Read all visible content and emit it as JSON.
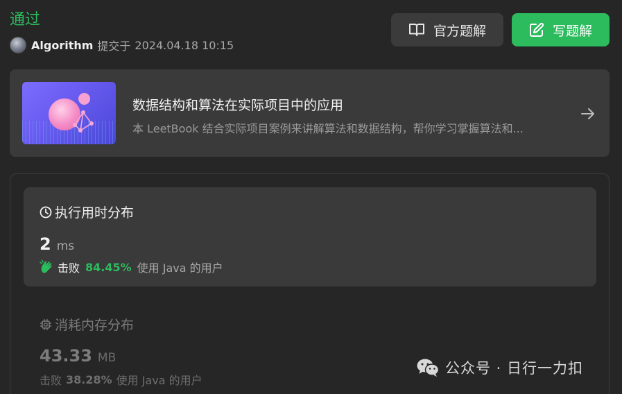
{
  "header": {
    "status": "通过",
    "username": "Algorithm",
    "submitted_label": "提交于",
    "submitted_time": "2024.04.18 10:15",
    "official_solution_label": "官方题解",
    "write_solution_label": "写题解"
  },
  "banner": {
    "title": "数据结构和算法在实际项目中的应用",
    "description": "本 LeetBook 结合实际项目案例来讲解算法和数据结构，帮你学习掌握算法和..."
  },
  "runtime": {
    "title": "执行用时分布",
    "value": "2",
    "unit": "ms",
    "beat_label": "击败",
    "beat_percent": "84.45%",
    "beat_suffix": "使用 Java 的用户"
  },
  "memory": {
    "title": "消耗内存分布",
    "value": "43.33",
    "unit": "MB",
    "beat_label": "击败",
    "beat_percent": "38.28%",
    "beat_suffix": "使用 Java 的用户"
  },
  "watermark": {
    "text": "公众号 · 日行一力扣"
  },
  "colors": {
    "accent_green": "#2cbb5d",
    "background": "#262626",
    "card": "#3a3a3a"
  },
  "icons": [
    "avatar",
    "book-icon",
    "edit-icon",
    "arrow-right-icon",
    "clock-icon",
    "clap-icon",
    "chip-icon",
    "wechat-icon"
  ]
}
